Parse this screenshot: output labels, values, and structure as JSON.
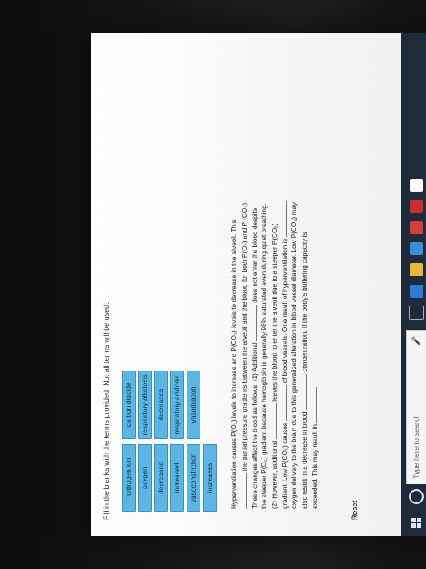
{
  "instructions": "Fill in the blanks with the terms provided. Not all terms will be used.",
  "word_bank": [
    [
      "hydrogen ion",
      "carbon dioxide"
    ],
    [
      "oxygen",
      "respiratory alkalosis"
    ],
    [
      "decreased",
      "decreases"
    ],
    [
      "increased",
      "respiratory acidosis"
    ],
    [
      "vasoconstriction",
      "vasodilation"
    ],
    [
      "increases",
      ""
    ]
  ],
  "passage": {
    "p1": "Hyperventilation causes P(O₂) levels to increase and P(CO₂) levels to decrease in the alveoli. This",
    "p2": "the partial pressure gradients between the alveoli and the blood for both P(O₂) and P",
    "p3": "(CO₂). These changes affect the blood as follows: (1) Additional",
    "p4": "does not enter the",
    "p5": "blood despite the steeper P(O₂) gradient because hemoglobin is generally 98% saturated even during",
    "p6": "quiet breathing. (2) However, additional",
    "p7": "leaves the blood to enter the alveoli due to a",
    "p8": "steeper P(CO₂) gradient. Low P(CO₂) causes",
    "p9": "of blood vessels. One result of",
    "p10": "hyperventilation is",
    "p11": "oxygen delivery to the brain due to this generalized alteration in",
    "p12": "blood vessel diameter. Low P(CO₂) may also result in a decrease in blood",
    "p13": "concentration. If the body's buffering capacity is exceeded. This may result in"
  },
  "reset_label": "Reset",
  "taskbar": {
    "search_placeholder": "Type here to search"
  },
  "colors": {
    "chip_fill": "#5bb6e4",
    "taskbar": "#1f2a3a"
  }
}
